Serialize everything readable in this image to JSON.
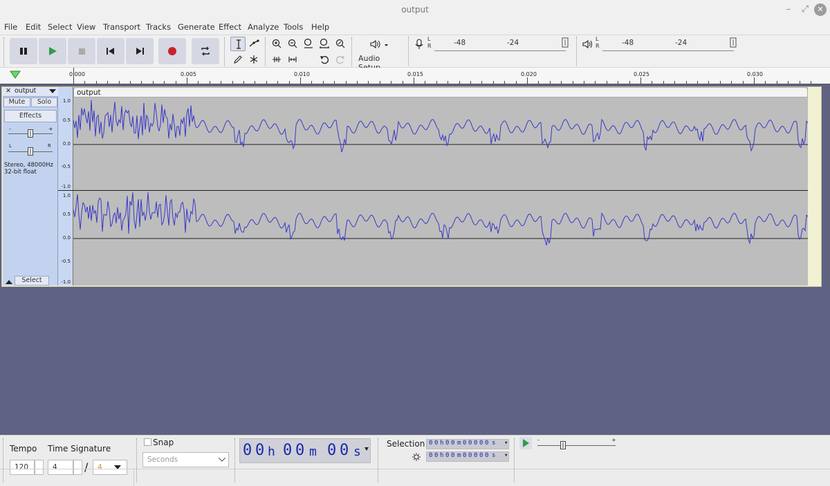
{
  "window": {
    "title": "output"
  },
  "menu": [
    "File",
    "Edit",
    "Select",
    "View",
    "Transport",
    "Tracks",
    "Generate",
    "Effect",
    "Analyze",
    "Tools",
    "Help"
  ],
  "toolbar": {
    "audio_setup_label": "Audio Setup",
    "record_meter_ticks": [
      "-48",
      "-24"
    ],
    "play_meter_ticks": [
      "-48",
      "-24"
    ],
    "meter_l": "L",
    "meter_r": "R"
  },
  "ruler": {
    "labels": [
      "0.000",
      "0.005",
      "0.010",
      "0.015",
      "0.020",
      "0.025",
      "0.030"
    ]
  },
  "track": {
    "name": "output",
    "mute_label": "Mute",
    "solo_label": "Solo",
    "effects_label": "Effects",
    "gain_minus": "-",
    "gain_plus": "+",
    "pan_left": "L",
    "pan_right": "R",
    "format_line1": "Stereo, 48000Hz",
    "format_line2": "32-bit float",
    "select_label": "Select",
    "clip_name": "output",
    "vruler_labels": [
      "1.0",
      "0.5",
      "0.0",
      "-0.5",
      "-1.0"
    ]
  },
  "bottom": {
    "tempo_label": "Tempo",
    "time_signature_label": "Time Signature",
    "tempo_value": "120",
    "ts_numerator": "4",
    "ts_slash": "/",
    "ts_denominator": "4",
    "snap_label": "Snap",
    "snap_unit": "Seconds",
    "time_digits": [
      "0",
      "0",
      "h",
      "0",
      "0",
      "m",
      "0",
      "0",
      "s"
    ],
    "selection_label": "Selection",
    "selection_start": [
      "0",
      "0",
      "h",
      "0",
      "0",
      "m",
      "0",
      "0",
      "0",
      "0",
      "0",
      "s"
    ],
    "selection_end": [
      "0",
      "0",
      "h",
      "0",
      "0",
      "m",
      "0",
      "0",
      "0",
      "0",
      "0",
      "s"
    ],
    "play_speed_minus": "-",
    "play_speed_plus": "+"
  }
}
